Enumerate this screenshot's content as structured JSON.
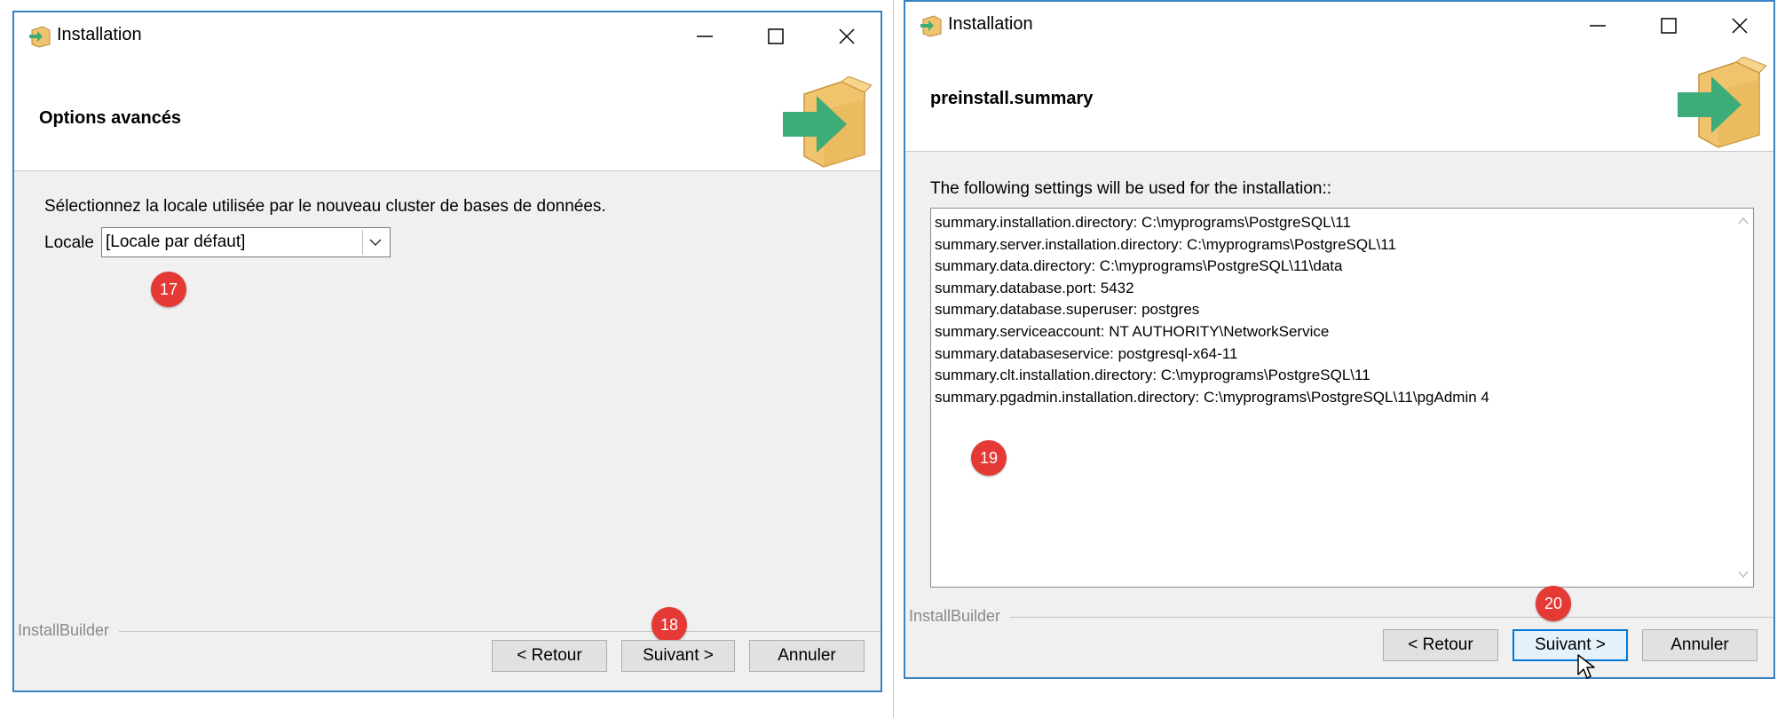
{
  "left": {
    "title": "Installation",
    "header": "Options avancés",
    "instruction": "Sélectionnez la locale utilisée par le nouveau cluster de bases de données.",
    "locale_label": "Locale",
    "locale_value": "[Locale par défaut]",
    "footer_brand": "InstallBuilder",
    "buttons": {
      "back": "< Retour",
      "next": "Suivant >",
      "cancel": "Annuler"
    },
    "badges": {
      "locale": "17",
      "next": "18"
    }
  },
  "right": {
    "title": "Installation",
    "header": "preinstall.summary",
    "intro": "The following settings will be used for the installation::",
    "summary_lines": [
      "summary.installation.directory: C:\\myprograms\\PostgreSQL\\11",
      "summary.server.installation.directory: C:\\myprograms\\PostgreSQL\\11",
      "summary.data.directory: C:\\myprograms\\PostgreSQL\\11\\data",
      "summary.database.port: 5432",
      "summary.database.superuser: postgres",
      "summary.serviceaccount: NT AUTHORITY\\NetworkService",
      "summary.databaseservice: postgresql-x64-11",
      "summary.clt.installation.directory: C:\\myprograms\\PostgreSQL\\11",
      "summary.pgadmin.installation.directory: C:\\myprograms\\PostgreSQL\\11\\pgAdmin 4"
    ],
    "footer_brand": "InstallBuilder",
    "buttons": {
      "back": "< Retour",
      "next": "Suivant >",
      "cancel": "Annuler"
    },
    "badges": {
      "summary": "19",
      "next": "20"
    }
  },
  "icons": {
    "app": "installer-box-arrow-icon",
    "minimize": "minimize-icon",
    "maximize": "maximize-icon",
    "close": "close-icon",
    "dropdown": "chevron-down-icon"
  },
  "colors": {
    "window_border": "#3b82c4",
    "badge": "#e53935",
    "arrow_green": "#3dac78",
    "box_tan": "#f0c36d"
  }
}
